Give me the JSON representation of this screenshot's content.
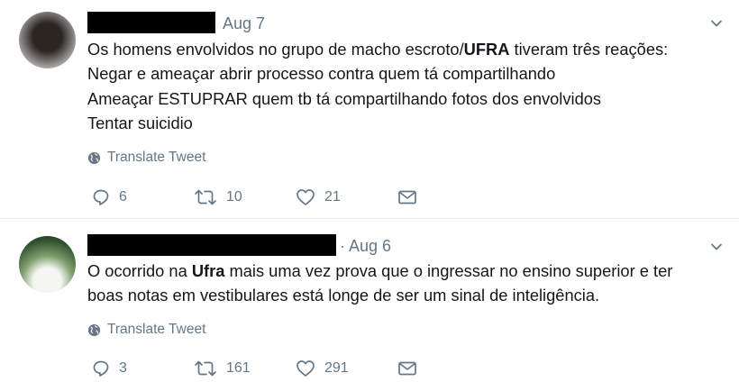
{
  "tweets": [
    {
      "date": "Aug 7",
      "lines": [
        {
          "before": "Os homens envolvidos no grupo de macho escroto/",
          "bold": "UFRA",
          "after": " tiveram três reações:"
        },
        {
          "before": "Negar e ameaçar abrir processo contra quem tá compartilhando",
          "bold": "",
          "after": ""
        },
        {
          "before": "Ameaçar ESTUPRAR quem tb tá compartilhando fotos dos envolvidos",
          "bold": "",
          "after": ""
        },
        {
          "before": "Tentar suicidio",
          "bold": "",
          "after": ""
        }
      ],
      "translate": "Translate Tweet",
      "replies": "6",
      "retweets": "10",
      "likes": "21"
    },
    {
      "date": "· Aug 6",
      "lines": [
        {
          "before": "O ocorrido na ",
          "bold": "Ufra",
          "after": " mais uma vez prova que o ingressar no ensino superior e ter"
        },
        {
          "before": "boas notas em vestibulares está longe de ser um sinal de inteligência.",
          "bold": "",
          "after": ""
        }
      ],
      "translate": "Translate Tweet",
      "replies": "3",
      "retweets": "161",
      "likes": "291"
    }
  ],
  "icons": {
    "globe": "globe-icon",
    "reply": "reply-icon",
    "retweet": "retweet-icon",
    "like": "heart-icon",
    "dm": "envelope-icon",
    "caret": "chevron-down-icon"
  },
  "colors": {
    "text": "#14171a",
    "muted": "#657786",
    "divider": "#e6ecf0"
  }
}
